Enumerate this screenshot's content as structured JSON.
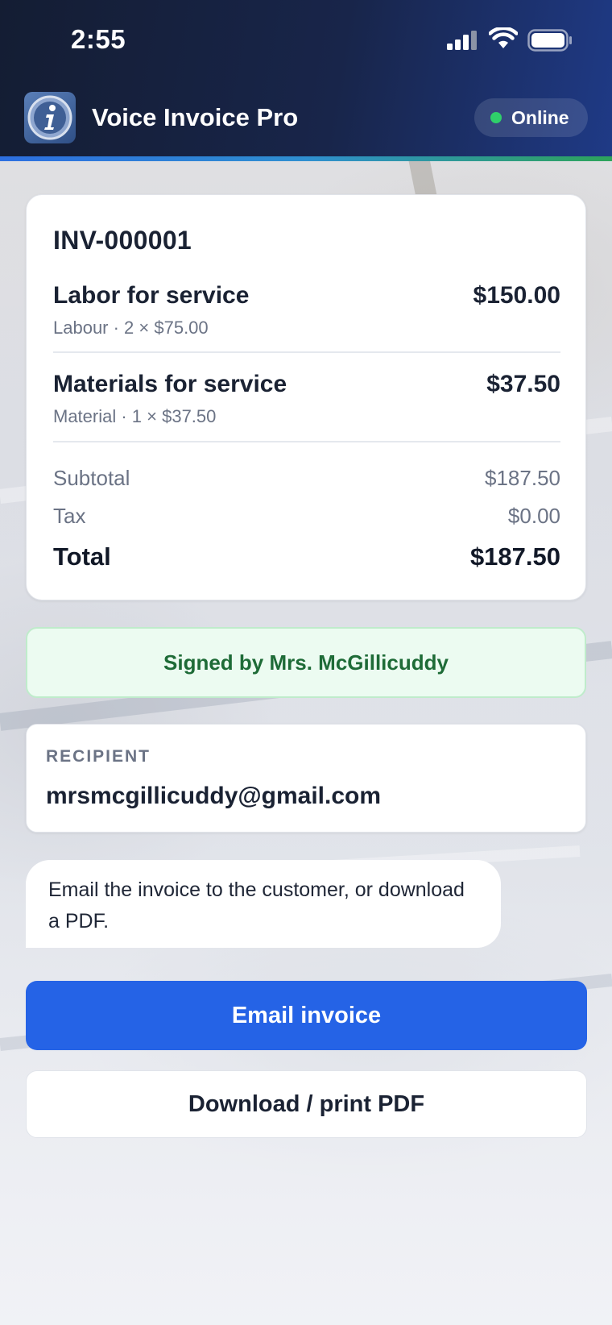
{
  "status_bar": {
    "time": "2:55",
    "icons": [
      "cellular-signal-icon",
      "wifi-icon",
      "battery-icon"
    ]
  },
  "header": {
    "logo_icon": "info-icon",
    "app_title": "Voice Invoice Pro",
    "connection_status": "Online",
    "status_color": "#2fd06a"
  },
  "invoice": {
    "number": "INV-000001",
    "line_items": [
      {
        "name": "Labor for service",
        "detail": "Labour · 2 × $75.00",
        "amount": "$150.00"
      },
      {
        "name": "Materials for service",
        "detail": "Material · 1 × $37.50",
        "amount": "$37.50"
      }
    ],
    "subtotal_label": "Subtotal",
    "subtotal_value": "$187.50",
    "tax_label": "Tax",
    "tax_value": "$0.00",
    "total_label": "Total",
    "total_value": "$187.50"
  },
  "signature": {
    "text": "Signed by Mrs. McGillicuddy",
    "color": "#1e6b37"
  },
  "recipient": {
    "label": "RECIPIENT",
    "email": "mrsmcgillicuddy@gmail.com"
  },
  "assistant_message": "Email the invoice to the customer, or download a PDF.",
  "actions": {
    "email_label": "Email invoice",
    "pdf_label": "Download / print PDF",
    "primary_color": "#2563e6"
  }
}
